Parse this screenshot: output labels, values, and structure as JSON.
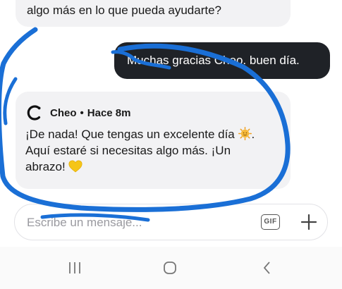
{
  "chat": {
    "previous_message_tail": "algo más en lo que pueda ayudarte?",
    "sent_message": "Muchas gracias Cheo. buen día.",
    "reply": {
      "author": "Cheo",
      "separator": "•",
      "time": "Hace 8m",
      "line1": "¡De nada! Que tengas un excelente día",
      "line2": "Aquí estaré si necesitas algo más. ¡Un",
      "line3": "abrazo!",
      "emoji_1": "sun-face-emoji",
      "emoji_2": "yellow-heart-emoji"
    }
  },
  "composer": {
    "placeholder": "Escribe un mensaje...",
    "gif_label": "GIF"
  },
  "navigation": {
    "icons": [
      "recent-apps-icon",
      "home-icon",
      "back-icon"
    ]
  },
  "colors": {
    "sent_bubble": "#1f2227",
    "received_bubble": "#f2f2f4",
    "annotation_stroke": "#1a6fd6",
    "heart": "#f5c518",
    "sun": "#f6b93b"
  }
}
